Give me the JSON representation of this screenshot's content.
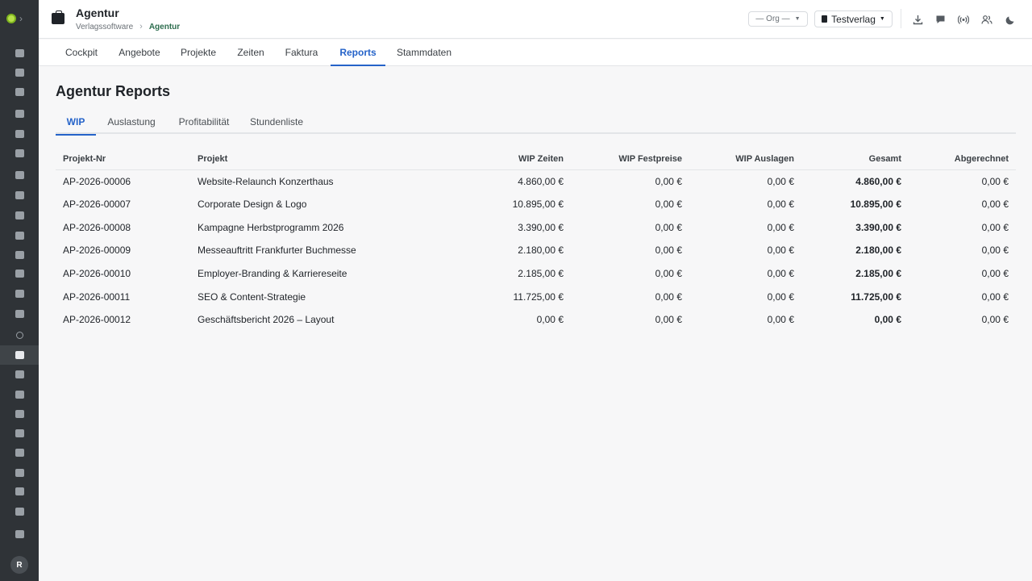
{
  "sidebar": {
    "icons": [
      "logo-icon",
      "chevron-right-icon",
      "dashboard-icon",
      "calendar-icon",
      "layout-icon",
      "user-edit-icon",
      "megaphone-icon",
      "send-icon",
      "lightbulb-icon",
      "library-icon",
      "image-icon",
      "briefcase-icon",
      "newspaper-icon",
      "receipt-icon",
      "feather-icon",
      "archive-icon",
      "circle-icon",
      "agency-icon",
      "speaker-icon",
      "printer-icon",
      "music-icon",
      "document-icon",
      "store-icon",
      "transfer-icon",
      "chart-icon",
      "book-icon",
      "shield-icon"
    ],
    "avatar_initial": "R"
  },
  "header": {
    "title": "Agentur",
    "breadcrumb_parent": "Verlagssoftware",
    "breadcrumb_current": "Agentur",
    "org_select": "— Org —",
    "verlag_select": "Testverlag",
    "actions": [
      "download-icon",
      "chat-icon",
      "broadcast-icon",
      "users-icon",
      "moon-icon"
    ]
  },
  "module_tabs": [
    "Cockpit",
    "Angebote",
    "Projekte",
    "Zeiten",
    "Faktura",
    "Reports",
    "Stammdaten"
  ],
  "active_module_tab": "Reports",
  "page_title": "Agentur Reports",
  "sub_tabs": [
    "WIP",
    "Auslastung",
    "Profitabilität",
    "Stundenliste"
  ],
  "active_sub_tab": "WIP",
  "table": {
    "columns": [
      "Projekt-Nr",
      "Projekt",
      "WIP Zeiten",
      "WIP Festpreise",
      "WIP Auslagen",
      "Gesamt",
      "Abgerechnet"
    ],
    "rows": [
      [
        "AP-2026-00006",
        "Website-Relaunch Konzerthaus",
        "4.860,00 €",
        "0,00 €",
        "0,00 €",
        "4.860,00 €",
        "0,00 €"
      ],
      [
        "AP-2026-00007",
        "Corporate Design & Logo",
        "10.895,00 €",
        "0,00 €",
        "0,00 €",
        "10.895,00 €",
        "0,00 €"
      ],
      [
        "AP-2026-00008",
        "Kampagne Herbstprogramm 2026",
        "3.390,00 €",
        "0,00 €",
        "0,00 €",
        "3.390,00 €",
        "0,00 €"
      ],
      [
        "AP-2026-00009",
        "Messeauftritt Frankfurter Buchmesse",
        "2.180,00 €",
        "0,00 €",
        "0,00 €",
        "2.180,00 €",
        "0,00 €"
      ],
      [
        "AP-2026-00010",
        "Employer-Branding & Karriereseite",
        "2.185,00 €",
        "0,00 €",
        "0,00 €",
        "2.185,00 €",
        "0,00 €"
      ],
      [
        "AP-2026-00011",
        "SEO & Content-Strategie",
        "11.725,00 €",
        "0,00 €",
        "0,00 €",
        "11.725,00 €",
        "0,00 €"
      ],
      [
        "AP-2026-00012",
        "Geschäftsbericht 2026 – Layout",
        "0,00 €",
        "0,00 €",
        "0,00 €",
        "0,00 €",
        "0,00 €"
      ]
    ]
  },
  "colors": {
    "accent": "#2563c9",
    "sidebar_bg": "#2f3337",
    "breadcrumb_current": "#2e6e4f"
  }
}
